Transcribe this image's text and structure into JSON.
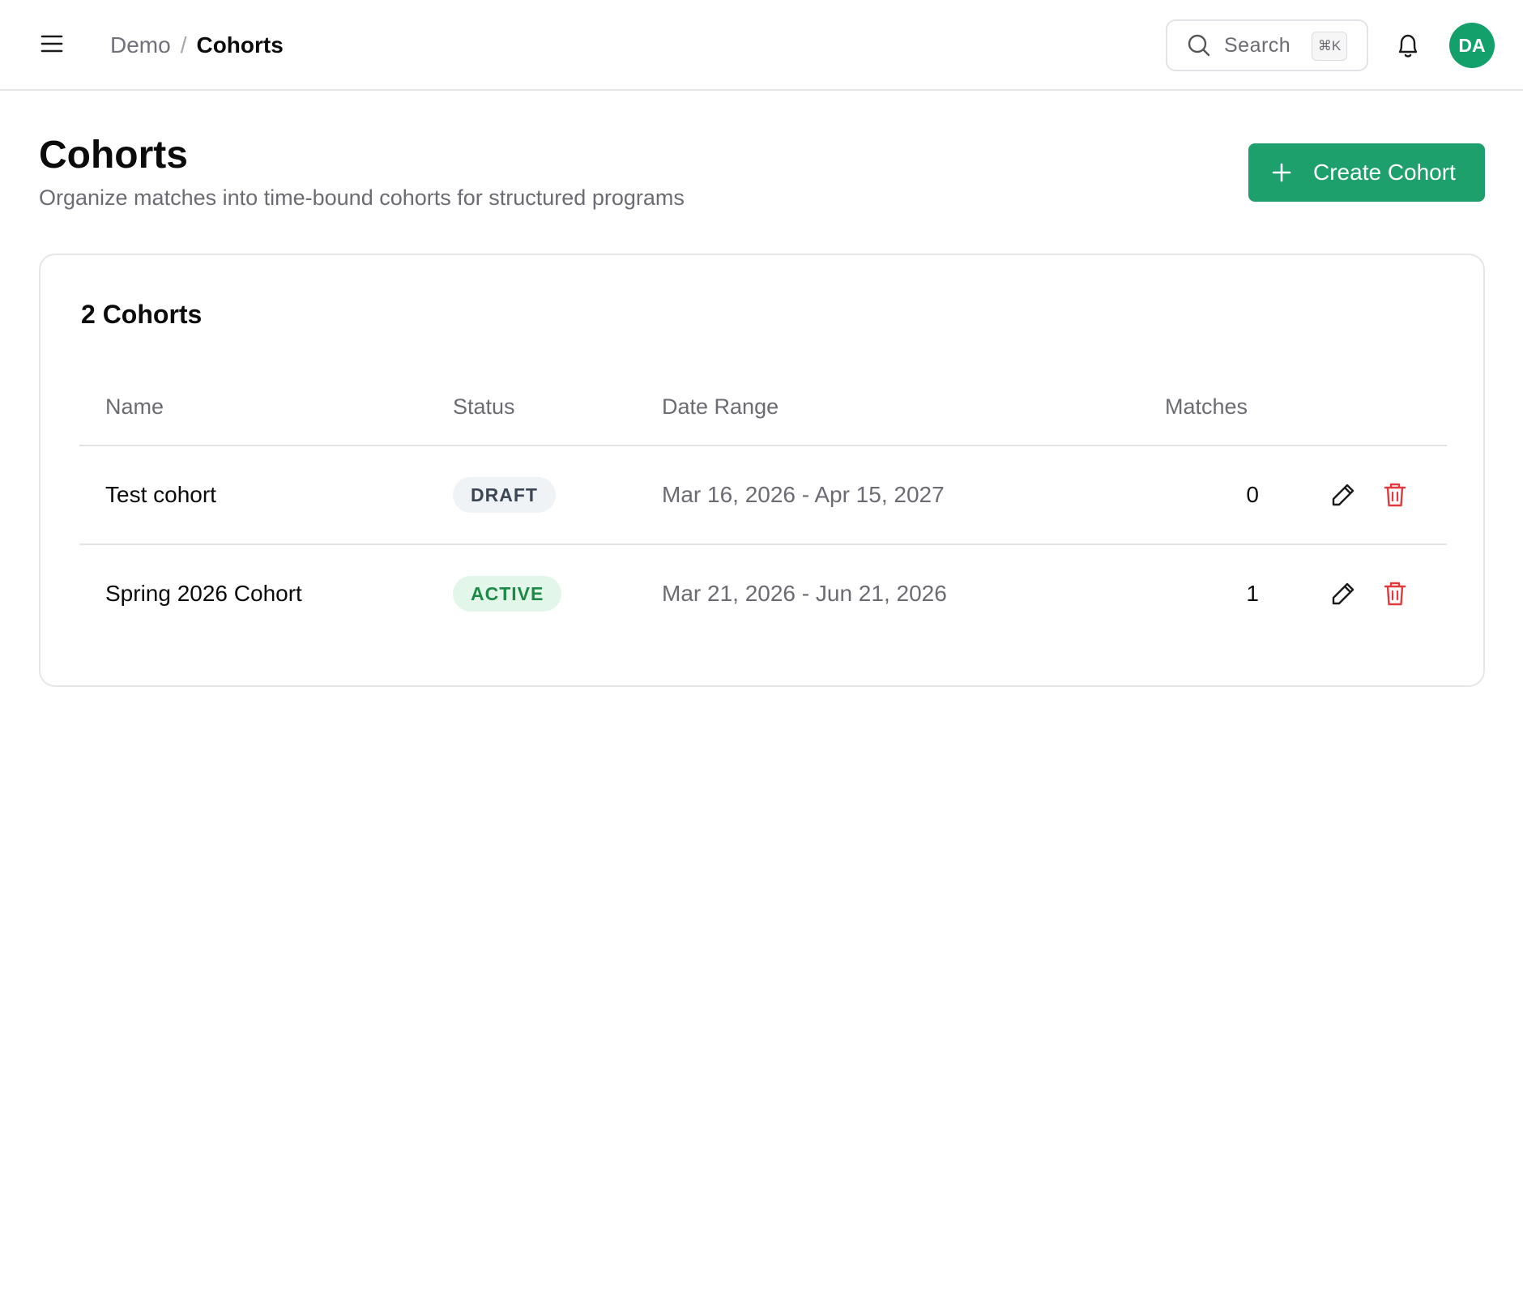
{
  "header": {
    "breadcrumb": {
      "parent": "Demo",
      "separator": "/",
      "current": "Cohorts"
    },
    "search": {
      "label": "Search",
      "shortcut": "⌘K"
    },
    "user": {
      "initials": "DA",
      "avatar_color": "#13a06a"
    }
  },
  "page": {
    "title": "Cohorts",
    "subtitle": "Organize matches into time-bound cohorts for structured programs",
    "create_button": "Create Cohort",
    "accent_color": "#1ea06c"
  },
  "cohorts": {
    "count_label": "2 Cohorts",
    "columns": {
      "name": "Name",
      "status": "Status",
      "date_range": "Date Range",
      "matches": "Matches"
    },
    "rows": [
      {
        "name": "Test cohort",
        "status": "DRAFT",
        "date_range": "Mar 16, 2026 - Apr 15, 2027",
        "matches": "0"
      },
      {
        "name": "Spring 2026 Cohort",
        "status": "ACTIVE",
        "date_range": "Mar 21, 2026 - Jun 21, 2026",
        "matches": "1"
      }
    ]
  },
  "icons": {
    "menu": "menu-icon",
    "search": "search-icon",
    "bell": "bell-icon",
    "plus": "plus-icon",
    "edit": "pencil-icon",
    "delete": "trash-icon",
    "delete_color": "#e0393e"
  }
}
